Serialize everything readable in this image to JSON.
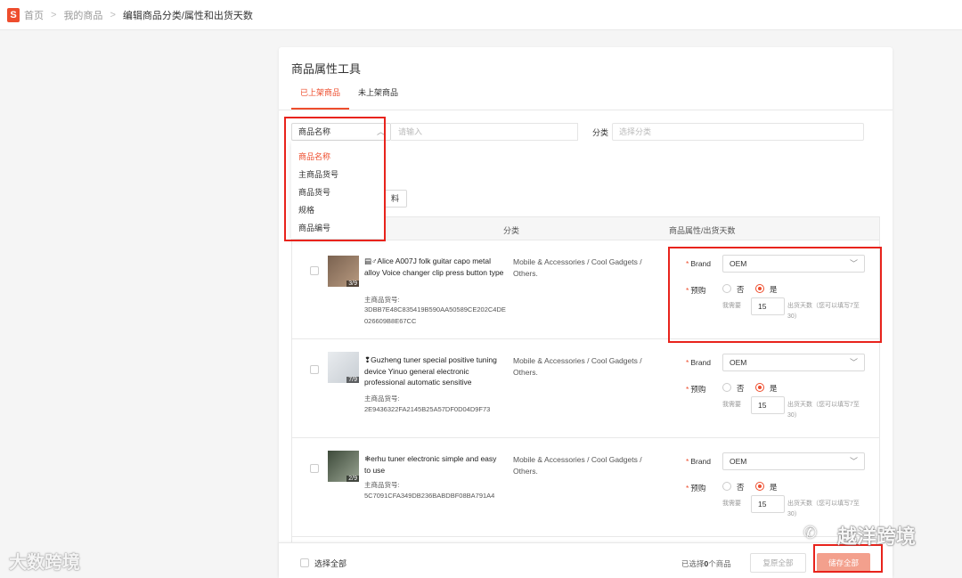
{
  "breadcrumb": {
    "logo": "S",
    "home": "首页",
    "my_products": "我的商品",
    "current": "编辑商品分类/属性和出货天数",
    "separator": ">"
  },
  "card": {
    "title": "商品属性工具",
    "tabs": [
      {
        "label": "已上架商品",
        "active": true
      },
      {
        "label": "未上架商品",
        "active": false
      }
    ]
  },
  "filter": {
    "field_selected": "商品名称",
    "keyword_placeholder": "请输入",
    "category_label": "分类",
    "category_placeholder": "选择分类",
    "dropdown_options": [
      "商品名称",
      "主商品货号",
      "商品货号",
      "规格",
      "商品编号"
    ],
    "partial_button_label": "料"
  },
  "table": {
    "headers": {
      "category": "分类",
      "attributes": "商品属性/出货天数"
    },
    "sku_label": "主商品货号:",
    "brand_label": "Brand",
    "preorder_label": "预购",
    "radio_no": "否",
    "radio_yes": "是",
    "need_label": "我需要",
    "days_hint": "出货天数（您可以填写7至30）",
    "rows": [
      {
        "name": "▤♂Alice A007J folk guitar capo metal alloy Voice changer clip press button type",
        "image_count": "3/9",
        "sku": "3DBB7E48C835419B590AA50589CE202C4DE026609B8E67CC",
        "category": "Mobile & Accessories / Cool Gadgets / Others.",
        "brand": "OEM",
        "preorder": "是",
        "days": "15"
      },
      {
        "name": "❢Guzheng tuner special positive tuning device Yinuo general electronic professional automatic sensitive",
        "image_count": "7/9",
        "sku": "2E9436322FA2145B25A57DF0D04D9F73",
        "category": "Mobile & Accessories / Cool Gadgets / Others.",
        "brand": "OEM",
        "preorder": "是",
        "days": "15"
      },
      {
        "name": "❄erhu tuner electronic simple and easy to use",
        "image_count": "2/9",
        "sku": "5C7091CFA349DB236BABDBF08BA791A4",
        "category": "Mobile & Accessories / Cool Gadgets / Others.",
        "brand": "OEM",
        "preorder": "是",
        "days": "15"
      }
    ]
  },
  "footer": {
    "select_all": "选择全部",
    "selected_prefix": "已选择",
    "selected_count": "0",
    "selected_suffix": "个商品",
    "reset_label": "复原全部",
    "save_label": "储存全部"
  },
  "watermarks": {
    "left": "大数跨境",
    "right": "越洋跨境"
  },
  "colors": {
    "accent": "#ee4d2d",
    "annotation": "#e8231c",
    "save_disabled": "#f3a08d"
  }
}
